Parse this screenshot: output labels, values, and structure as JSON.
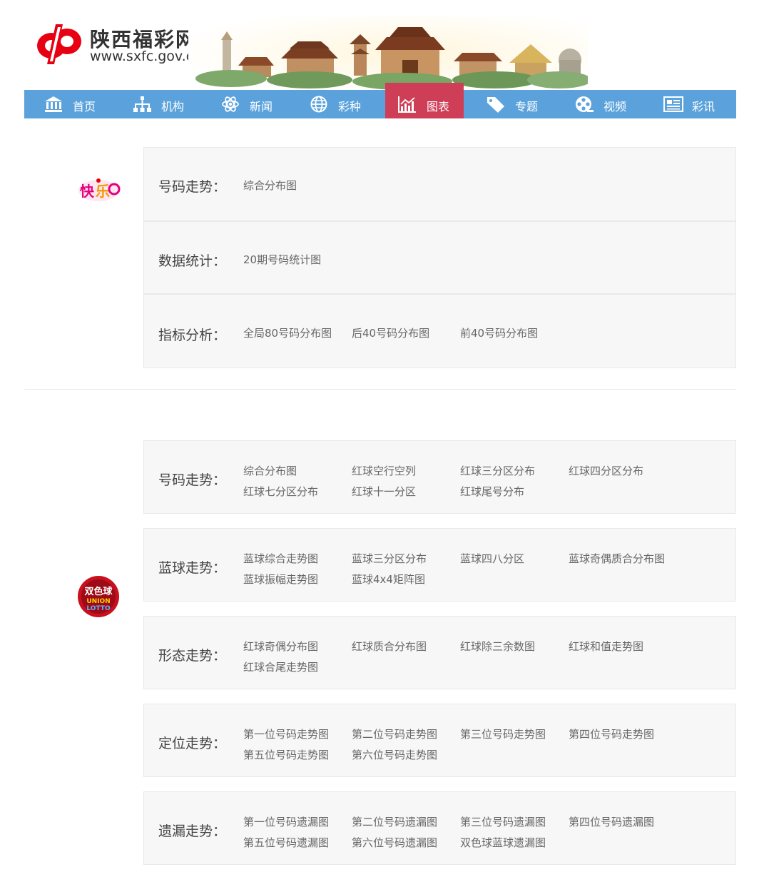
{
  "header": {
    "site_name": "陕西福彩网",
    "site_url": "www.sxfc.gov.cn"
  },
  "nav": {
    "items": [
      {
        "label": "首页",
        "icon": "bank-icon"
      },
      {
        "label": "机构",
        "icon": "org-chart-icon"
      },
      {
        "label": "新闻",
        "icon": "atom-icon"
      },
      {
        "label": "彩种",
        "icon": "globe-icon"
      },
      {
        "label": "图表",
        "icon": "chart-icon",
        "active": true
      },
      {
        "label": "专题",
        "icon": "tag-icon"
      },
      {
        "label": "视频",
        "icon": "film-reel-icon"
      },
      {
        "label": "彩讯",
        "icon": "newspaper-icon"
      }
    ]
  },
  "kuaile8": {
    "rows": [
      {
        "label": "号码走势：",
        "links": [
          "综合分布图"
        ]
      },
      {
        "label": "数据统计：",
        "links": [
          "20期号码统计图"
        ]
      },
      {
        "label": "指标分析：",
        "links": [
          "全局80号码分布图",
          "后40号码分布图",
          "前40号码分布图"
        ]
      }
    ]
  },
  "shuangseqiu": {
    "rows": [
      {
        "label": "号码走势：",
        "links": [
          "综合分布图",
          "红球空行空列",
          "红球三分区分布",
          "红球四分区分布",
          "红球七分区分布",
          "红球十一分区",
          "红球尾号分布"
        ]
      },
      {
        "label": "蓝球走势：",
        "links": [
          "蓝球综合走势图",
          "蓝球三分区分布",
          "蓝球四八分区",
          "蓝球奇偶质合分布图",
          "蓝球振幅走势图",
          "蓝球4x4矩阵图"
        ]
      },
      {
        "label": "形态走势：",
        "links": [
          "红球奇偶分布图",
          "红球质合分布图",
          "红球除三余数图",
          "红球和值走势图",
          "红球合尾走势图"
        ]
      },
      {
        "label": "定位走势：",
        "links": [
          "第一位号码走势图",
          "第二位号码走势图",
          "第三位号码走势图",
          "第四位号码走势图",
          "第五位号码走势图",
          "第六位号码走势图"
        ]
      },
      {
        "label": "遗漏走势：",
        "links": [
          "第一位号码遗漏图",
          "第二位号码遗漏图",
          "第三位号码遗漏图",
          "第四位号码遗漏图",
          "第五位号码遗漏图",
          "第六位号码遗漏图",
          "双色球蓝球遗漏图"
        ]
      }
    ]
  },
  "colors": {
    "nav_bg": "#5ba2dc",
    "nav_active": "#cf3e57",
    "brand_red": "#e60012"
  }
}
